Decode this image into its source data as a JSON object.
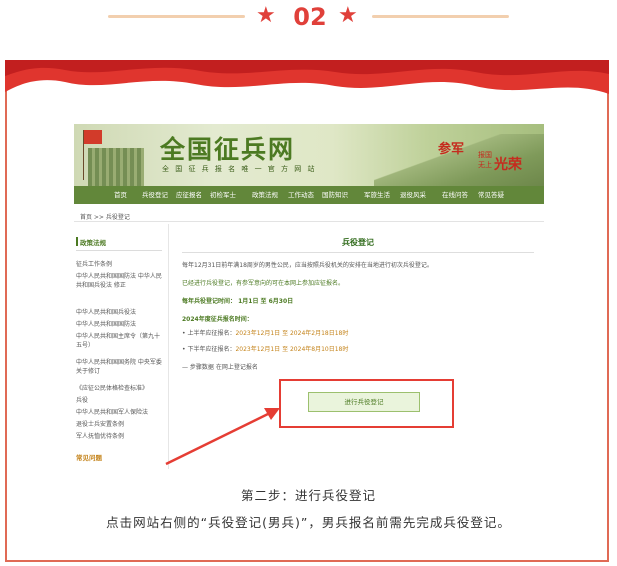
{
  "header": {
    "step_number": "02",
    "star_icon": "★",
    "accent": "#e0403a"
  },
  "site": {
    "banner_title": "全国征兵网",
    "banner_subtitle": "全 国 征 兵 报 名 唯 一 官 方 网 站",
    "slogan_1": "参军",
    "slogan_2": "报国",
    "slogan_3": "光荣",
    "slogan_4": "无上",
    "nav": [
      "首页",
      "兵役登记",
      "应征报名",
      "初检军士",
      "政策法规",
      "工作动态",
      "国防知识",
      "军旅生活",
      "退役风采",
      "在线问答",
      "常见答疑"
    ],
    "breadcrumb": "首页 >> 兵役登记",
    "sidebar": {
      "title": "政策法规",
      "items": [
        "征兵工作条例",
        "中华人民共和国国防法 中华人民共和国兵役法 修正",
        "中华人民共和国兵役法",
        "中华人民共和国国防法",
        "中华人民共和国主席令（第九十五号）",
        "中华人民共和国国务院 中央军委关于修订",
        "《应征公民体格检查标准》",
        "兵役",
        "中华人民共和国军人保险法",
        "退役士兵安置条例",
        "军人抚恤优待条例"
      ],
      "footer": "常见问题"
    },
    "main": {
      "title": "兵役登记",
      "para1": "每年12月31日前年满18周岁的男性公民，应当按照兵役机关的安排在当地进行初次兵役登记。",
      "para2": "已经进行兵役登记，有参军意向的可在本网上参加应征报名。",
      "para3_label": "每年兵役登记时间：",
      "para3_value": "1月1日 至 6月30日",
      "para4": "2024年度征兵报名时间：",
      "line5_label": "• 上半年应征报名：",
      "line5_value": "2023年12月1日 至 2024年2月18日18时",
      "line6_label": "• 下半年应征报名：",
      "line6_value": "2023年12月1日 至 2024年8月10日18时",
      "line7": "— 步骤数据 在网上登记报名",
      "button": "进行兵役登记"
    }
  },
  "caption": {
    "line1": "第二步：进行兵役登记",
    "line2": "点击网站右侧的“兵役登记(男兵)”，男兵报名前需先完成兵役登记。"
  }
}
